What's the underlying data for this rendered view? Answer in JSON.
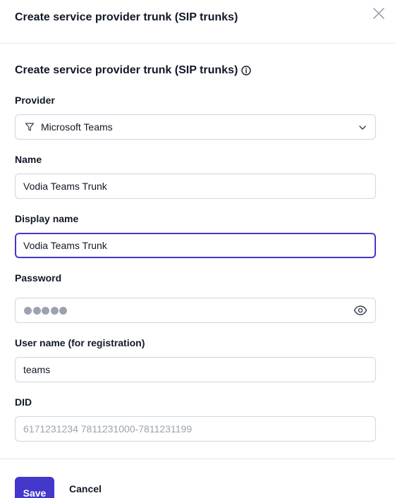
{
  "dialog": {
    "title": "Create service provider trunk (SIP trunks)",
    "close_icon": "close-icon"
  },
  "form": {
    "section_title": "Create service provider trunk (SIP trunks)",
    "info_icon": "info-icon",
    "provider": {
      "label": "Provider",
      "value": "Microsoft Teams",
      "icon": "filter-icon"
    },
    "name": {
      "label": "Name",
      "value": "Vodia Teams Trunk"
    },
    "display_name": {
      "label": "Display name",
      "value": "Vodia Teams Trunk"
    },
    "password": {
      "label": "Password",
      "masked_length": 5,
      "toggle_icon": "eye-icon"
    },
    "user_name": {
      "label": "User name (for registration)",
      "value": "teams"
    },
    "did": {
      "label": "DID",
      "value": "",
      "placeholder": "6171231234 7811231000-7811231199"
    }
  },
  "footer": {
    "save_label": "Save",
    "cancel_label": "Cancel"
  },
  "colors": {
    "accent": "#4338ca",
    "border": "#d1d5db",
    "text": "#111827",
    "placeholder": "#9ca3af"
  }
}
